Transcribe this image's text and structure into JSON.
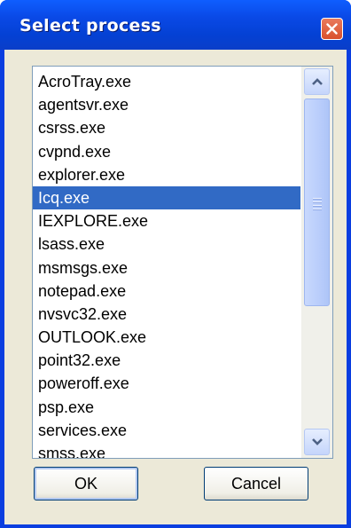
{
  "window": {
    "title": "Select process",
    "close_icon": "close-x-icon"
  },
  "process_list": {
    "items": [
      "AcroTray.exe",
      "agentsvr.exe",
      "csrss.exe",
      "cvpnd.exe",
      "explorer.exe",
      "Icq.exe",
      "IEXPLORE.exe",
      "lsass.exe",
      "msmsgs.exe",
      "notepad.exe",
      "nvsvc32.exe",
      "OUTLOOK.exe",
      "point32.exe",
      "poweroff.exe",
      "psp.exe",
      "services.exe",
      "smss.exe"
    ],
    "selected_index": 5
  },
  "buttons": {
    "ok_label": "OK",
    "cancel_label": "Cancel"
  },
  "colors": {
    "title_bar": "#0a49e6",
    "selection": "#316ac5",
    "dialog_face": "#ece9d8",
    "close_button": "#d9502d"
  }
}
